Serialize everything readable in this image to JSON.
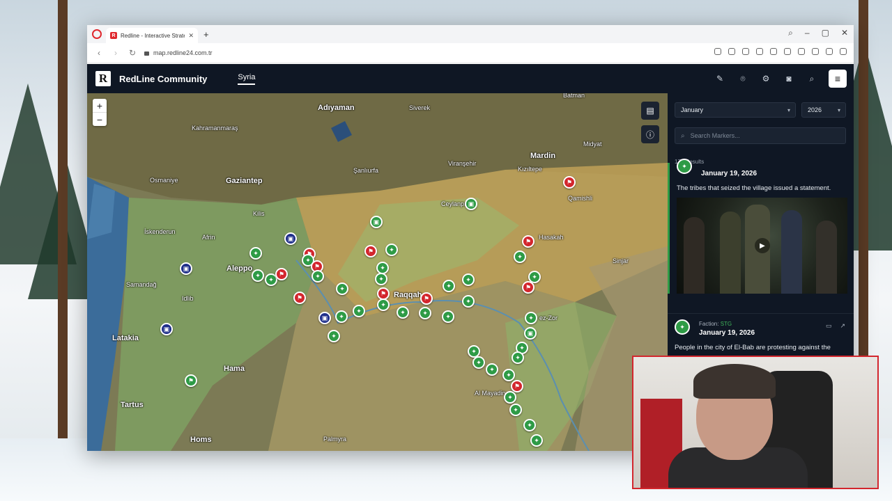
{
  "browser": {
    "tab_title": "Redline - Interactive Strate",
    "favicon_letter": "R",
    "new_tab_glyph": "+",
    "url": "map.redline24.com.tr"
  },
  "app": {
    "logo_letter": "R",
    "brand": "RedLine Community",
    "nav": [
      "Syria"
    ],
    "zoom_in": "+",
    "zoom_out": "−",
    "menu_glyph": "≡"
  },
  "map_labels": {
    "adiyaman": "Adıyaman",
    "kahramanmaras": "Kahramanmaraş",
    "gaziantep": "Gaziantep",
    "sanliurfa": "Şanlıurfa",
    "mardin": "Mardin",
    "batman": "Batman",
    "siverek": "Siverek",
    "osmaniye": "Osmaniye",
    "iskenderun": "İskenderun",
    "aleppo": "Aleppo",
    "idlib": "Idlib",
    "latakia": "Latakia",
    "tartus": "Tartus",
    "homs": "Homs",
    "hama": "Hama",
    "raqqa": "Raqqah",
    "hasakah": "Hasakah",
    "palmyra": "Palmyra",
    "deir": "Deir ez-Zor",
    "al_mayadin": "Al Mayadin",
    "midyat": "Midyat",
    "kiziltepe": "Kızıltepe",
    "ceylanpinar": "Ceylanpınar",
    "viransehir": "Viranşehir",
    "kilis": "Kilis",
    "afrin": "Afrin",
    "samandag": "Samandağ",
    "sinjar": "Sinjar",
    "qamishli": "Qamishli"
  },
  "panel": {
    "month": "January",
    "year": "2026",
    "search_placeholder": "Search Markers...",
    "results": "175 Results",
    "posts": [
      {
        "date": "January 19, 2026",
        "text": "The tribes that seized the village issued a statement."
      },
      {
        "faction_label": "Faction:",
        "faction": "STG",
        "date": "January 19, 2026",
        "text": "People in the city of El-Bab are protesting against the"
      }
    ]
  },
  "colors": {
    "green_marker": "#2e9b46",
    "red_marker": "#d3262d",
    "navy_marker": "#1f2f8a",
    "panel_bg": "#0f1724"
  },
  "icons": [
    "opera-icon",
    "pen-icon",
    "pin-icon",
    "gear-icon",
    "camera-icon",
    "search-icon",
    "menu-icon",
    "map-layers-icon",
    "info-icon",
    "play-icon",
    "video-icon",
    "external-link-icon"
  ]
}
